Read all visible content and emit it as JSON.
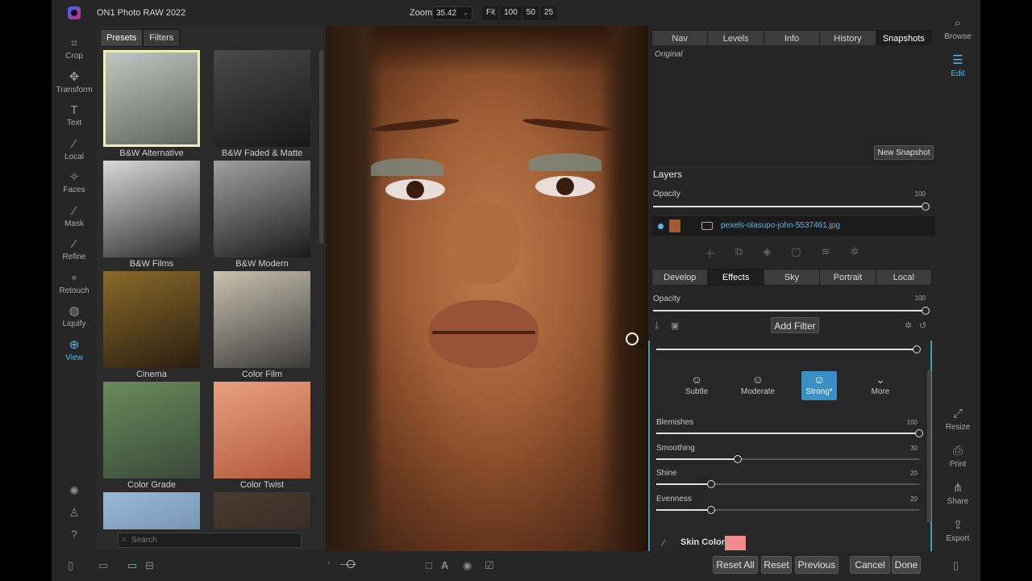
{
  "app": {
    "title": "ON1 Photo RAW 2022"
  },
  "zoom": {
    "label": "Zoom",
    "value": "35.42",
    "buttons": [
      "Fit",
      "100",
      "50",
      "25"
    ]
  },
  "left_tools": [
    {
      "label": "Crop",
      "icon": "crop-icon",
      "glyph": "⌗"
    },
    {
      "label": "Transform",
      "icon": "transform-icon",
      "glyph": "✥"
    },
    {
      "label": "Text",
      "icon": "text-icon",
      "glyph": "T"
    },
    {
      "label": "Local",
      "icon": "local-brush-icon",
      "glyph": "⁄"
    },
    {
      "label": "Faces",
      "icon": "faces-icon",
      "glyph": "✧"
    },
    {
      "label": "Mask",
      "icon": "mask-icon",
      "glyph": "⁄"
    },
    {
      "label": "Refine",
      "icon": "refine-icon",
      "glyph": "⁄"
    },
    {
      "label": "Retouch",
      "icon": "retouch-icon",
      "glyph": "∘"
    },
    {
      "label": "Liquify",
      "icon": "liquify-icon",
      "glyph": "◍"
    },
    {
      "label": "View",
      "icon": "view-icon",
      "glyph": "⊕"
    }
  ],
  "browser_tabs": [
    "Presets",
    "Filters"
  ],
  "presets": [
    {
      "name": "B&W Alternative",
      "colors": [
        "#c4c8c4",
        "#5c625c"
      ],
      "selected": true
    },
    {
      "name": "B&W Faded & Matte",
      "colors": [
        "#4a4a4a",
        "#181818"
      ],
      "selected": false
    },
    {
      "name": "B&W Films",
      "colors": [
        "#d9d9d9",
        "#2a2a2a"
      ],
      "selected": false
    },
    {
      "name": "B&W Modern",
      "colors": [
        "#a0a0a0",
        "#1a1a1a"
      ],
      "selected": false
    },
    {
      "name": "Cinema",
      "colors": [
        "#8a6a2a",
        "#2a1e10"
      ],
      "selected": false
    },
    {
      "name": "Color Film",
      "colors": [
        "#c9c2b0",
        "#3a3a36"
      ],
      "selected": false
    },
    {
      "name": "Color Grade",
      "colors": [
        "#6a8a5a",
        "#3a4a3a"
      ],
      "selected": false
    },
    {
      "name": "Color Twist",
      "colors": [
        "#e9a080",
        "#b0583a"
      ],
      "selected": false
    },
    {
      "name": "",
      "colors": [
        "#9ab8d8",
        "#5a7a9a"
      ],
      "selected": false
    },
    {
      "name": "",
      "colors": [
        "#4a3c30",
        "#2a221c"
      ],
      "selected": false
    }
  ],
  "search": {
    "placeholder": "Search"
  },
  "info_tabs": [
    "Nav",
    "Levels",
    "Info",
    "History",
    "Snapshots"
  ],
  "snapshots": {
    "item": "Original",
    "new_button": "New Snapshot"
  },
  "layers": {
    "title": "Layers",
    "opacity_label": "Opacity",
    "opacity_value": "100",
    "layer_name": "pexels-olasupo-john-5537461.jpg"
  },
  "module_tabs": [
    "Develop",
    "Effects",
    "Sky",
    "Portrait",
    "Local"
  ],
  "effects": {
    "opacity_label": "Opacity",
    "opacity_value": "100",
    "add_filter": "Add Filter"
  },
  "face_presets": [
    {
      "label": "Subtle",
      "icon": "face-subtle-icon",
      "active": false
    },
    {
      "label": "Moderate",
      "icon": "face-moderate-icon",
      "active": false
    },
    {
      "label": "Strong*",
      "icon": "face-strong-icon",
      "active": true
    },
    {
      "label": "More",
      "icon": "more-chevron-icon",
      "active": false
    }
  ],
  "skin_sliders": [
    {
      "label": "Blemishes",
      "value": "100",
      "fraction": 1.0
    },
    {
      "label": "Smoothing",
      "value": "30",
      "fraction": 0.31
    },
    {
      "label": "Shine",
      "value": "20",
      "fraction": 0.21
    },
    {
      "label": "Evenness",
      "value": "20",
      "fraction": 0.21
    }
  ],
  "skin_color": {
    "label": "Skin Color:",
    "color": "#f08c8c"
  },
  "right_tools": [
    {
      "label": "Browse",
      "icon": "browse-icon",
      "active": false
    },
    {
      "label": "Edit",
      "icon": "edit-sliders-icon",
      "active": true
    }
  ],
  "right_tools_bottom": [
    {
      "label": "Resize",
      "icon": "resize-icon"
    },
    {
      "label": "Print",
      "icon": "print-icon"
    },
    {
      "label": "Share",
      "icon": "share-icon"
    },
    {
      "label": "Export",
      "icon": "export-icon"
    }
  ],
  "bottom_buttons": {
    "reset_all": "Reset All",
    "reset": "Reset",
    "previous": "Previous",
    "cancel": "Cancel",
    "done": "Done"
  },
  "accent": "#5ab8e8"
}
